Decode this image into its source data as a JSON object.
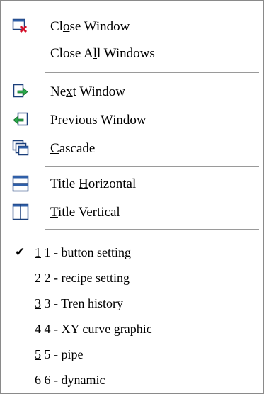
{
  "menu": {
    "items": [
      {
        "pre": "Cl",
        "u": "o",
        "post": "se Window",
        "icon": "close-window-icon"
      },
      {
        "pre": "Close A",
        "u": "l",
        "post": "l Windows",
        "icon": ""
      },
      {
        "pre": "Ne",
        "u": "x",
        "post": "t Window",
        "icon": "next-window-icon"
      },
      {
        "pre": "Pre",
        "u": "v",
        "post": "ious Window",
        "icon": "previous-window-icon"
      },
      {
        "pre": "",
        "u": "C",
        "post": "ascade",
        "icon": "cascade-icon"
      },
      {
        "pre": "Title ",
        "u": "H",
        "post": "orizontal",
        "icon": "tile-horizontal-icon"
      },
      {
        "pre": "",
        "u": "T",
        "post": "itle Vertical",
        "icon": "tile-vertical-icon"
      }
    ],
    "windows": [
      {
        "num": "1",
        "text": " 1 - button setting",
        "checked": true
      },
      {
        "num": "2",
        "text": " 2 - recipe setting",
        "checked": false
      },
      {
        "num": "3",
        "text": " 3 - Tren history",
        "checked": false
      },
      {
        "num": "4",
        "text": " 4 - XY curve graphic",
        "checked": false
      },
      {
        "num": "5",
        "text": " 5 - pipe",
        "checked": false
      },
      {
        "num": "6",
        "text": " 6 - dynamic",
        "checked": false
      }
    ],
    "check_glyph": "✔"
  }
}
